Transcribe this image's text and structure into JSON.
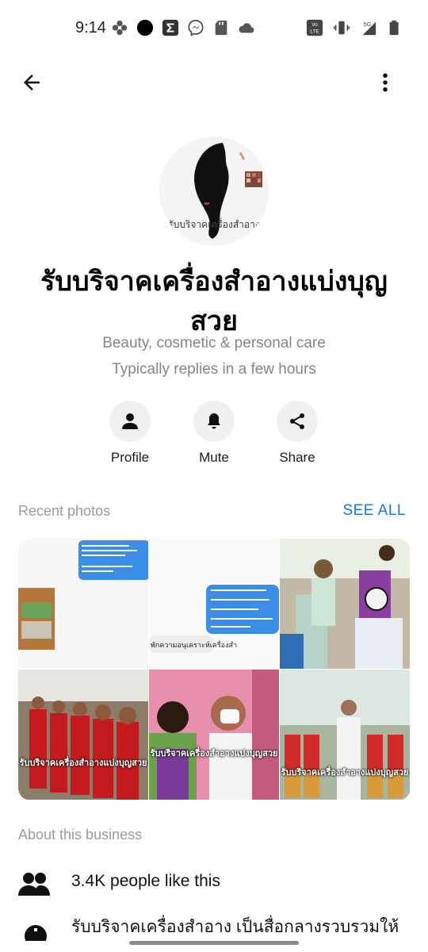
{
  "status_bar": {
    "time": "9:14",
    "left_icons": [
      "pinwheel-icon",
      "black-circle-icon",
      "sigma-icon",
      "messenger-icon",
      "sd-card-icon",
      "cloud-icon"
    ],
    "right_icons": [
      "volte-icon",
      "vibrate-icon",
      "signal-5g-icon",
      "battery-icon"
    ],
    "network_label": "5G",
    "volte_label": "Vo LTE"
  },
  "app_bar": {
    "back_icon": "arrow-left-icon",
    "more_icon": "more-vertical-icon"
  },
  "profile": {
    "avatar_caption": "รับบริจาคเครื่องสำอาง",
    "name": "รับบริจาคเครื่องสำอางแบ่งบุญสวย",
    "category": "Beauty, cosmetic & personal care",
    "reply_time": "Typically replies in a few hours"
  },
  "actions": [
    {
      "label": "Profile",
      "icon": "person-icon"
    },
    {
      "label": "Mute",
      "icon": "bell-icon"
    },
    {
      "label": "Share",
      "icon": "share-icon"
    }
  ],
  "recent_photos": {
    "title": "Recent photos",
    "see_all": "SEE ALL",
    "overlay_caption": "รับบริจาคเครื่องสำอางแบ่งบุญสวย",
    "chat_caption": "พักความอนุเคราะห์เครื่องสำ"
  },
  "about": {
    "title": "About this business",
    "likes": "3.4K people like this",
    "description": "รับบริจาคเครื่องสำอาง เป็นสื่อกลางรวบรวมให้"
  },
  "colors": {
    "accent": "#1b74e4",
    "muted": "#858585",
    "circle_bg": "#f0f0f0"
  }
}
